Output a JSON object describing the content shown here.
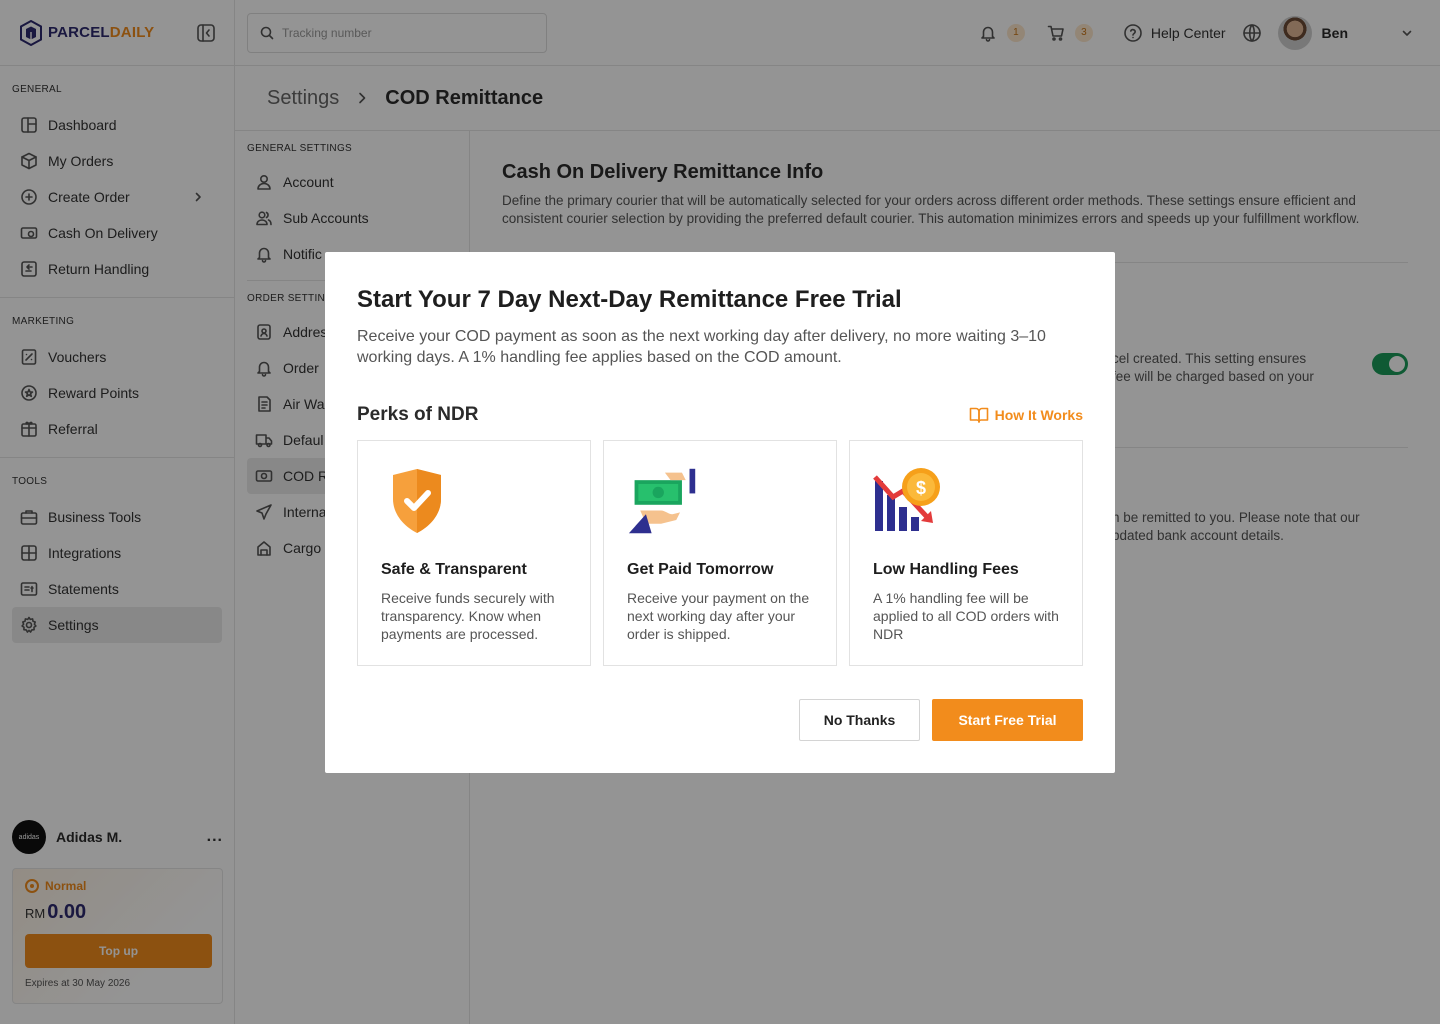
{
  "brand": {
    "name_a": "PARCEL",
    "name_b": "DAILY"
  },
  "search": {
    "placeholder": "Tracking number"
  },
  "header": {
    "notifications": "1",
    "cart": "3",
    "help": "Help Center",
    "user": "Ben"
  },
  "sidebar": {
    "general_label": "GENERAL",
    "general": [
      {
        "label": "Dashboard",
        "icon": "dashboard-icon"
      },
      {
        "label": "My Orders",
        "icon": "box-icon"
      },
      {
        "label": "Create Order",
        "icon": "plus-circle-icon"
      },
      {
        "label": "Cash On Delivery",
        "icon": "cash-icon"
      },
      {
        "label": "Return Handling",
        "icon": "return-icon"
      }
    ],
    "marketing_label": "MARKETING",
    "marketing": [
      {
        "label": "Vouchers",
        "icon": "voucher-icon"
      },
      {
        "label": "Reward Points",
        "icon": "reward-icon"
      },
      {
        "label": "Referral",
        "icon": "referral-icon"
      }
    ],
    "tools_label": "TOOLS",
    "tools": [
      {
        "label": "Business Tools",
        "icon": "briefcase-icon"
      },
      {
        "label": "Integrations",
        "icon": "integrations-icon"
      },
      {
        "label": "Statements",
        "icon": "statements-icon"
      },
      {
        "label": "Settings",
        "icon": "settings-icon"
      }
    ],
    "account": {
      "name": "Adidas M.",
      "avatar_text": "adidas",
      "more": "..."
    },
    "wallet": {
      "tier": "Normal",
      "currency": "RM",
      "amount": "0.00",
      "topup": "Top up",
      "expires": "Expires at 30 May 2026"
    }
  },
  "breadcrumb": {
    "parent": "Settings",
    "current": "COD Remittance"
  },
  "settings_nav": {
    "general_label": "GENERAL SETTINGS",
    "general": [
      {
        "label": "Account",
        "icon": "user-icon"
      },
      {
        "label": "Sub Accounts",
        "icon": "users-icon"
      },
      {
        "label": "Notific",
        "icon": "bell-icon"
      }
    ],
    "order_label": "ORDER SETTINGS",
    "order": [
      {
        "label": "Addres",
        "icon": "address-icon"
      },
      {
        "label": "Order",
        "icon": "order-bell-icon"
      },
      {
        "label": "Air Wa",
        "icon": "airwaybill-icon"
      },
      {
        "label": "Defaul",
        "icon": "truck-icon"
      },
      {
        "label": "COD R",
        "icon": "cod-icon"
      },
      {
        "label": "Interna",
        "icon": "plane-icon"
      },
      {
        "label": "Cargo",
        "icon": "cargo-icon"
      }
    ]
  },
  "main": {
    "title": "Cash On Delivery Remittance Info",
    "desc": "Define the primary courier that will be automatically selected for your orders across different order methods. These settings ensure efficient and consistent courier selection by providing the preferred default courier. This automation minimizes errors and speeds up your fulfillment workflow.",
    "row1_line1": "cel created. This setting ensures",
    "row1_line2": "fee will be charged based on your",
    "row2_line1": "n be remitted to you. Please note that our",
    "row2_line2": "pdated bank account details.",
    "toggle_on": true
  },
  "modal": {
    "title": "Start Your 7 Day Next-Day Remittance Free Trial",
    "subtitle": "Receive your COD payment as soon as the next working day after delivery, no more waiting 3–10 working days. A 1% handling fee applies based on the COD amount.",
    "perks_title": "Perks of NDR",
    "how_it_works": "How It Works",
    "cards": [
      {
        "title": "Safe & Transparent",
        "desc": "Receive funds securely with transparency. Know when payments are processed.",
        "icon": "shield-check-icon"
      },
      {
        "title": "Get Paid Tomorrow",
        "desc": "Receive your payment on the next working day after your order is shipped.",
        "icon": "cash-hand-icon"
      },
      {
        "title": "Low Handling Fees",
        "desc": "A 1% handling fee will be applied to all COD orders with NDR",
        "icon": "fee-chart-icon"
      }
    ],
    "no_thanks": "No Thanks",
    "start": "Start Free Trial"
  },
  "colors": {
    "accent": "#f28c1c",
    "brand_navy": "#2d2a6e",
    "toggle": "#1b9c5a"
  }
}
